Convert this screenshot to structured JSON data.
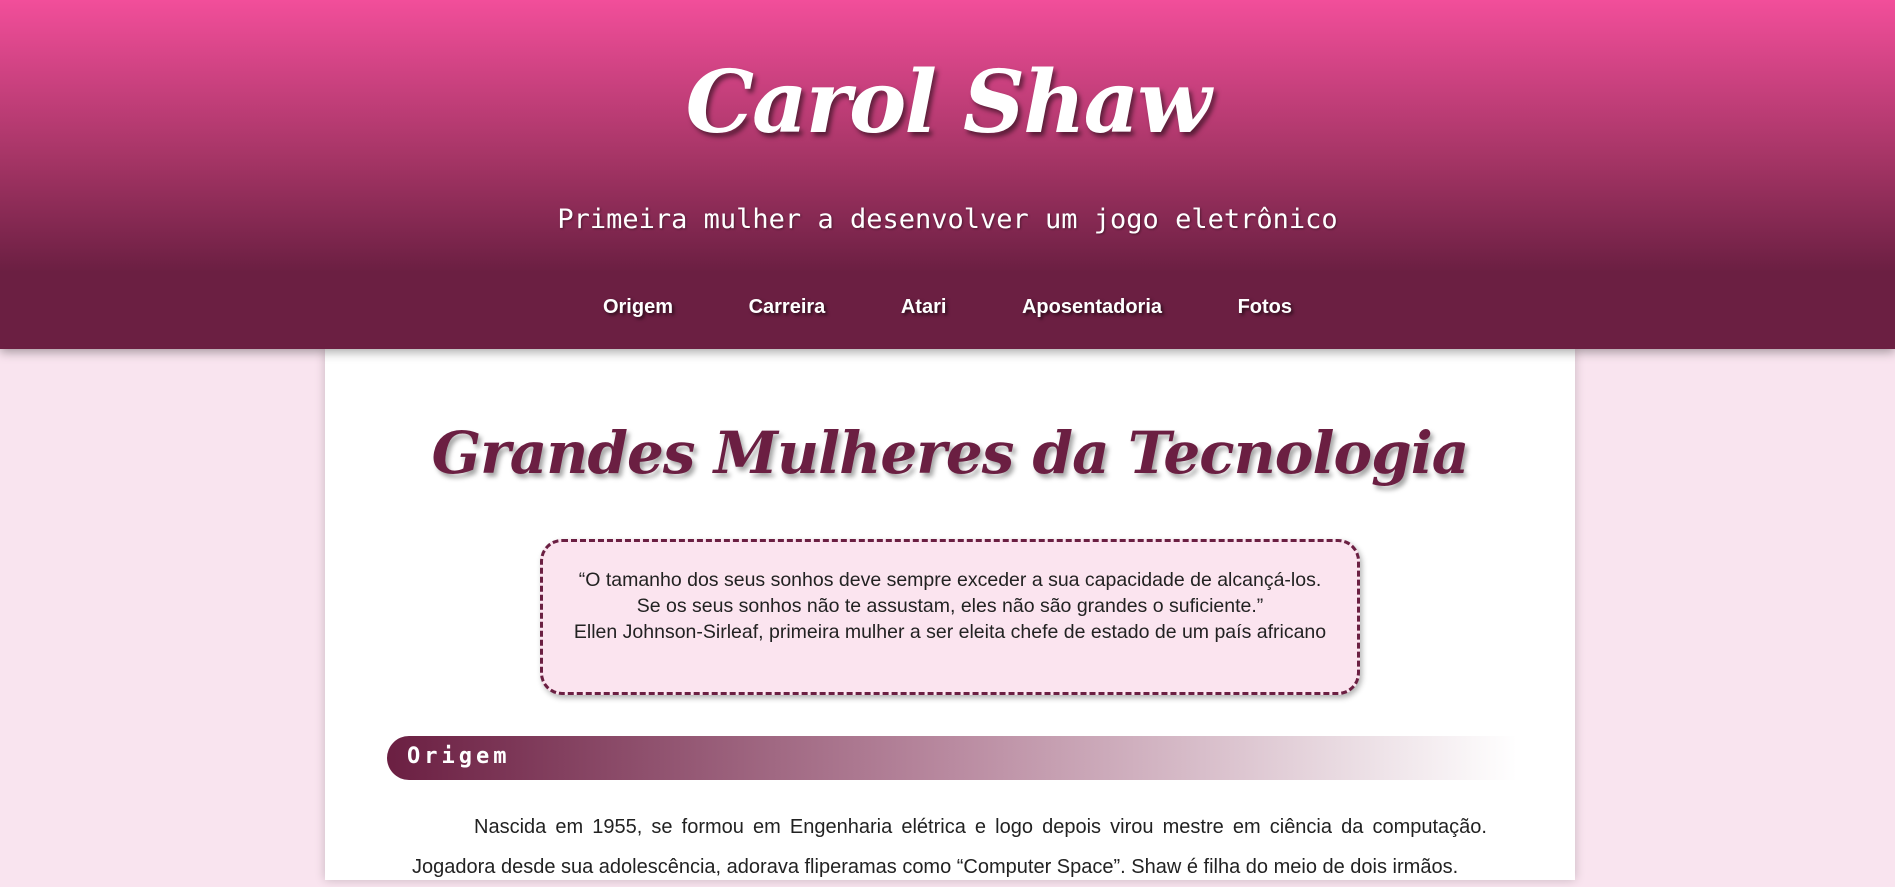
{
  "header": {
    "title": "Carol Shaw",
    "subtitle": "Primeira mulher a desenvolver um jogo eletrônico"
  },
  "nav": {
    "items": [
      {
        "label": "Origem"
      },
      {
        "label": "Carreira"
      },
      {
        "label": "Atari"
      },
      {
        "label": "Aposentadoria"
      },
      {
        "label": "Fotos"
      }
    ]
  },
  "main": {
    "heading": "Grandes Mulheres da Tecnologia",
    "quote": {
      "line1": "“O tamanho dos seus sonhos deve sempre exceder a sua capacidade de alcançá-los.",
      "line2": "Se os seus sonhos não te assustam, eles não são grandes o suficiente.”",
      "attribution": "Ellen Johnson-Sirleaf, primeira mulher a ser eleita chefe de estado de um país africano"
    },
    "sections": [
      {
        "title": "Origem",
        "text": "Nascida em 1955, se formou em Engenharia elétrica e logo depois virou mestre em ciência da computação. Jogadora desde sua adolescência, adorava fliperamas como “Computer Space”. Shaw é filha do meio de dois irmãos."
      }
    ]
  },
  "colors": {
    "header_top": "#f24e9a",
    "header_bottom": "#6b1f42",
    "accent": "#6b1f42",
    "page_background": "#f9e4ef",
    "quote_background": "#fbe4ef"
  }
}
